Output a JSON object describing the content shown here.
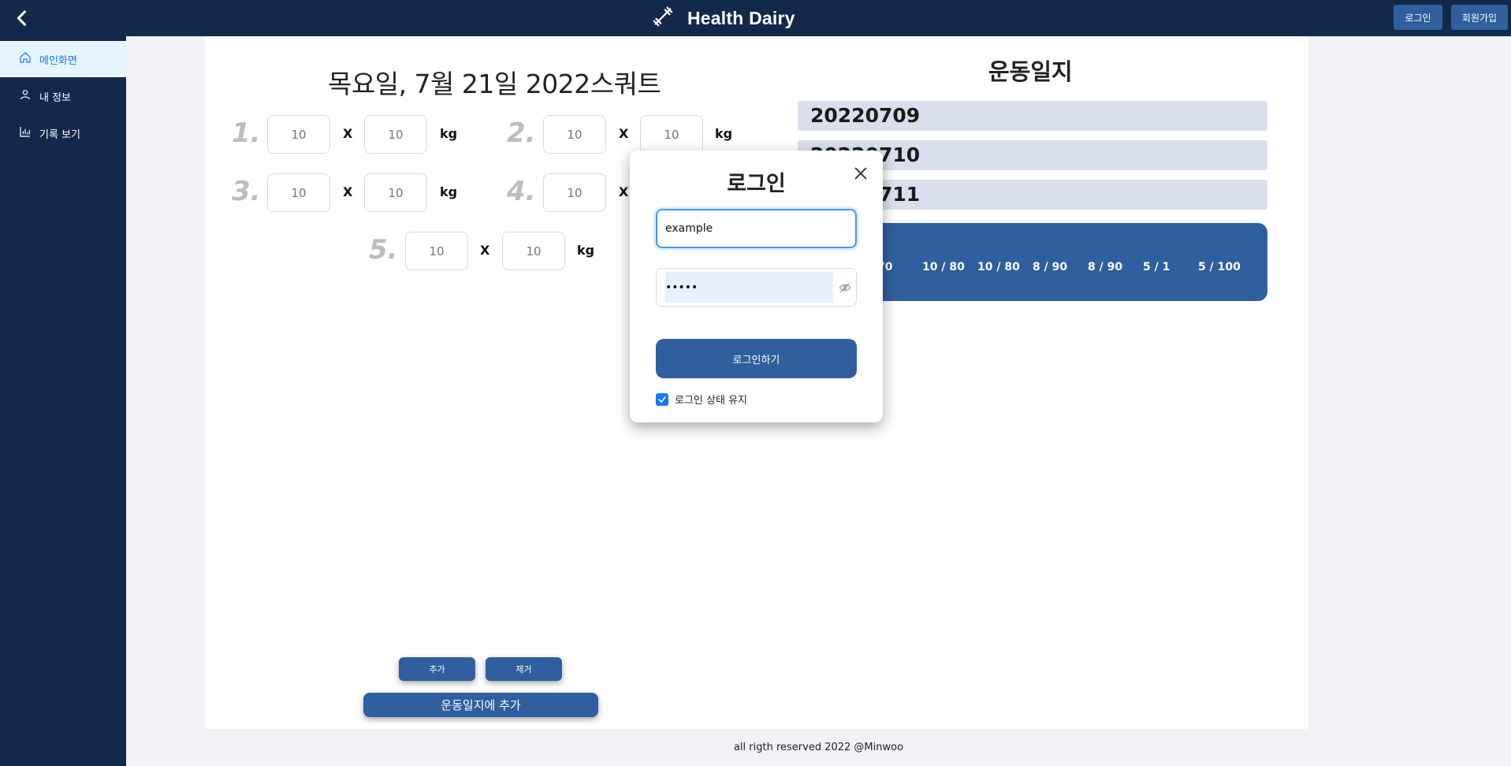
{
  "header": {
    "brand_title": "Health Dairy",
    "login_label": "로그인",
    "signup_label": "회원가입"
  },
  "sidebar": {
    "items": [
      {
        "label": "메인화면",
        "icon": "home-icon",
        "active": true
      },
      {
        "label": "내 정보",
        "icon": "user-icon",
        "active": false
      },
      {
        "label": "기록 보기",
        "icon": "bar-chart-icon",
        "active": false
      }
    ]
  },
  "workout": {
    "title": "목요일, 7월 21일 2022스쿼트",
    "x_label": "X",
    "kg_label": "kg",
    "sets": [
      {
        "num": "1.",
        "reps": "10",
        "weight": "10"
      },
      {
        "num": "2.",
        "reps": "10",
        "weight": "10"
      },
      {
        "num": "3.",
        "reps": "10",
        "weight": "10"
      },
      {
        "num": "4.",
        "reps": "10",
        "weight": "10"
      },
      {
        "num": "5.",
        "reps": "10",
        "weight": "10"
      }
    ],
    "add_label": "추가",
    "remove_label": "제거",
    "add_to_log_label": "운동일지에 추가"
  },
  "log": {
    "title": "운동일지",
    "dates": [
      "20220709",
      "20220710",
      "20220711"
    ],
    "details": [
      "/ 70",
      "10 / 80",
      "10 / 80",
      "8 / 90",
      "8 / 90",
      "5 / 1",
      "5 / 100"
    ]
  },
  "footer": {
    "text": "all rigth reserved 2022 @Minwoo"
  },
  "modal": {
    "title": "로그인",
    "username_value": "example",
    "password_value": "•••••",
    "submit_label": "로그인하기",
    "remember_label": "로그인 상태 유지",
    "remember_checked": true
  },
  "colors": {
    "nav_bg": "#13294b",
    "accent": "#2f5f9e",
    "active_bg": "#e6f4ff",
    "active_fg": "#1677ff",
    "log_row_bg": "#d9dfec"
  }
}
